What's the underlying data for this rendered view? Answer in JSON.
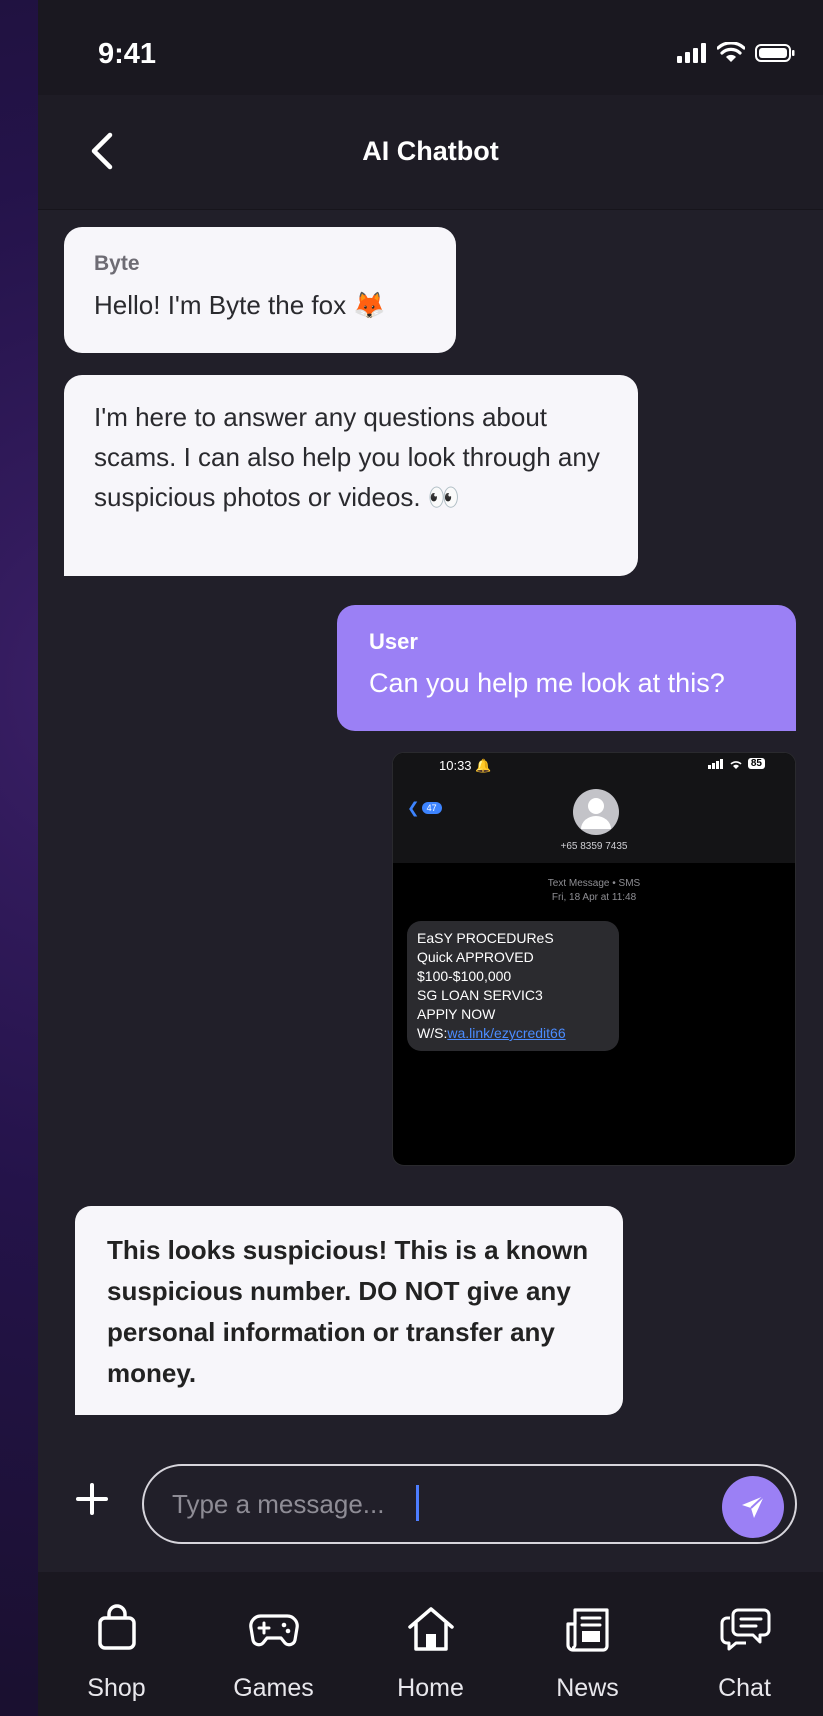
{
  "status_bar": {
    "time": "9:41"
  },
  "header": {
    "title": "AI Chatbot"
  },
  "messages": [
    {
      "sender": "Byte",
      "text": "Hello! I'm Byte the fox 🦊"
    },
    {
      "text": "I'm here to answer any questions about scams. I can also help you look through any suspicious photos or videos. 👀"
    },
    {
      "sender": "User",
      "text": "Can you help me look at this?"
    },
    {
      "text": "This looks suspicious! This is a known suspicious number. DO NOT give any personal information or transfer any money."
    }
  ],
  "attachment": {
    "time": "10:33",
    "battery": "85",
    "back_count": "47",
    "phone_number": "+65 8359 7435",
    "meta_line1": "Text Message • SMS",
    "meta_line2": "Fri, 18 Apr at 11:48",
    "sms_text": "EaSY PROCEDUReS\nQuick APPROVED\n$100-$100,000\nSG LOAN SERVIC3\nAPPlY NOW\nW/S:",
    "sms_link": "wa.link/ezycredit66"
  },
  "composer": {
    "placeholder": "Type a message..."
  },
  "tabs": [
    {
      "label": "Shop",
      "icon": "bag-icon"
    },
    {
      "label": "Games",
      "icon": "gamepad-icon"
    },
    {
      "label": "Home",
      "icon": "home-icon"
    },
    {
      "label": "News",
      "icon": "newspaper-icon"
    },
    {
      "label": "Chat",
      "icon": "chat-icon"
    }
  ],
  "colors": {
    "accent": "#9b80f5",
    "background": "#211f29",
    "bubble": "#f7f6fa"
  }
}
